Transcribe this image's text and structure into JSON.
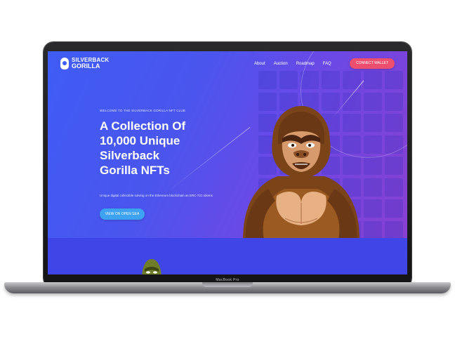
{
  "device": {
    "model_label": "MacBook Pro"
  },
  "site": {
    "logo": {
      "line1": "SILVERBACK",
      "line2": "GORILLA"
    },
    "nav": [
      "About",
      "Auction",
      "Roadmap",
      "FAQ"
    ],
    "connect_button": "CONNECT WALLET",
    "hero": {
      "eyebrow": "WELCOME TO THE SILVERBACK GORILLA NFT CLUB",
      "headline_lines": [
        "A Collection Of",
        "10,000 Unique",
        "Silverback",
        "Gorilla NFTs"
      ],
      "subtitle": "Unique digital collectible solving on the Ethereum blockchain as ERC-721 tokens",
      "cta_button": "VIEW ON OPEN SEA"
    }
  },
  "icons": {
    "logo": "gorilla-logo-icon",
    "hero": "gorilla-illustration",
    "below": "gorilla-illustration-small"
  },
  "colors": {
    "hero_gradient_start": "#3f5cf5",
    "hero_gradient_end": "#8b3fcf",
    "connect_button": "#ef4f6f",
    "cta_button": "#3ea2f2",
    "lower_band": "#3f45e6"
  }
}
